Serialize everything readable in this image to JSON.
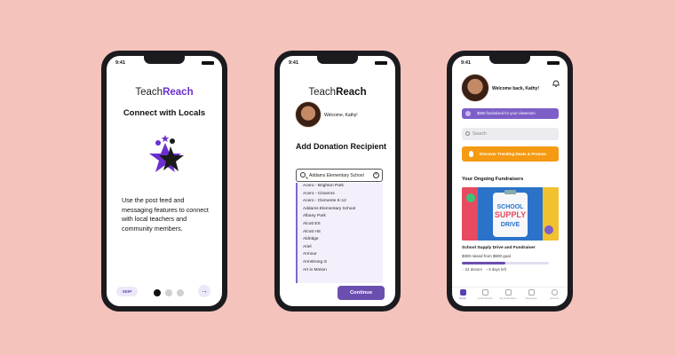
{
  "status_time": "9:41",
  "phone1": {
    "brand_a": "Teach",
    "brand_b": "Reach",
    "heading": "Connect with Locals",
    "body": "Use the post feed and messaging features to connect with local teachers and community members.",
    "skip_label": "SKIP",
    "next_glyph": "→",
    "pager": {
      "total": 3,
      "active": 1
    }
  },
  "phone2": {
    "brand_a": "Teach",
    "brand_b": "Reach",
    "welcome": "Welcome, Kathy!",
    "heading": "Add Donation Recipient",
    "search_value": "Addams Elementary School",
    "clear_glyph": "×",
    "options": [
      "Acero - Brighton Park",
      "Acero - Cisneros",
      "Acero - Clemente K-12",
      "Addams Elementary School",
      "Albany Park",
      "Alcott ES",
      "Alcott HS",
      "Aldridge",
      "Ariel",
      "Armour",
      "Armstrong G",
      "Art in Motion"
    ],
    "continue_label": "Continue"
  },
  "phone3": {
    "welcome": "Welcome back, Kathy!",
    "raised_banner": "$560 fundraised for your classroom",
    "search_placeholder": "Search",
    "trending_button": "Discover Trending Deals & Promos",
    "section_title": "Your Ongoing Fundraisers",
    "banner_text": {
      "line1": "SCHOOL",
      "line2": "SUPPLY",
      "line3": "DRIVE"
    },
    "fundraiser": {
      "title": "School Supply Drive and Fundraiser",
      "raised_text": "$300 raised from $600 goal",
      "progress": 0.5,
      "donors": "22 donors",
      "days_left": "9 days left"
    },
    "nav": [
      "Home",
      "Local Schools",
      "My Fundraisers",
      "Messages",
      "Account"
    ]
  },
  "colors": {
    "accent": "#6a2fd0",
    "button": "#6b4fb0",
    "orange": "#f59a12",
    "background": "#f4c3bb"
  }
}
